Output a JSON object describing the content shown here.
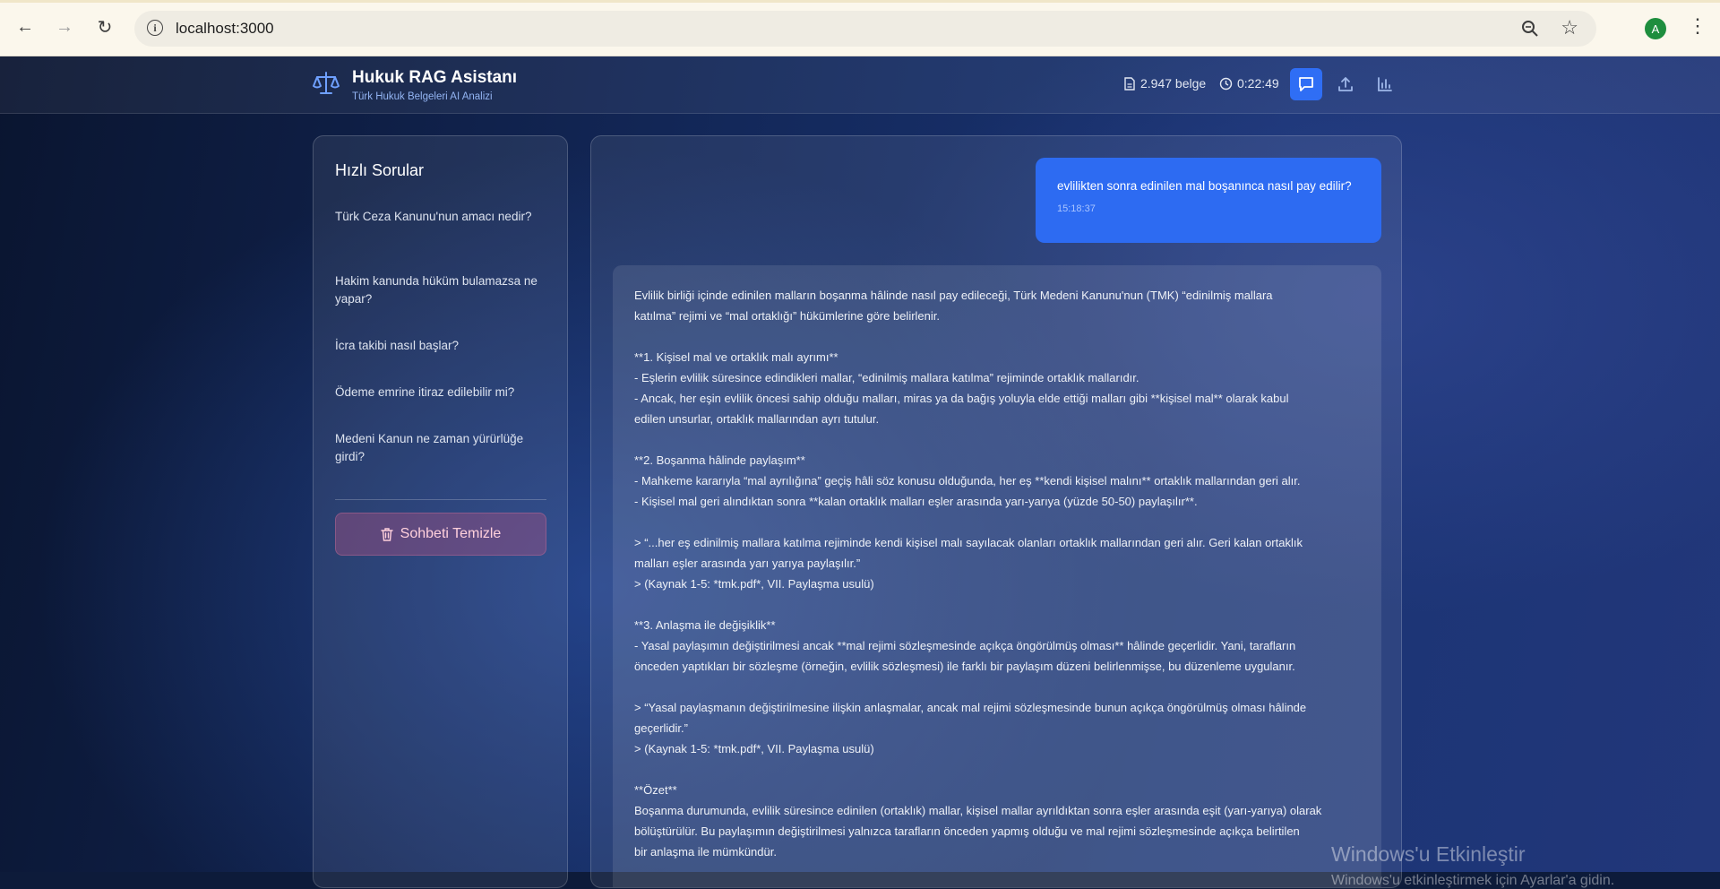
{
  "browser": {
    "url": "localhost:3000",
    "profile_initial": "A"
  },
  "header": {
    "title": "Hukuk RAG Asistanı",
    "subtitle": "Türk Hukuk Belgeleri AI Analizi",
    "doc_count": "2.947 belge",
    "timer": "0:22:49",
    "accent_color": "#2f6ef5"
  },
  "sidebar": {
    "title": "Hızlı Sorular",
    "questions": [
      "Türk Ceza Kanunu'nun amacı nedir?",
      "Hakim kanunda hüküm bulamazsa ne yapar?",
      "İcra takibi nasıl başlar?",
      "Ödeme emrine itiraz edilebilir mi?",
      "Medeni Kanun ne zaman yürürlüğe girdi?"
    ],
    "clear_label": "Sohbeti Temizle"
  },
  "chat": {
    "user_message": "evlilikten sonra edinilen mal boşanınca nasıl pay edilir?",
    "user_time": "15:18:37",
    "answer": [
      [
        "Evlilik birliği içinde edinilen malların boşanma hâlinde nasıl pay edileceği, Türk Medeni Kanunu'nun (TMK) “edinilmiş mallara",
        "katılma” rejimi ve “mal ortaklığı” hükümlerine göre belirlenir."
      ],
      [
        "**1. Kişisel mal ve ortaklık malı ayrımı**",
        "- Eşlerin evlilik süresince edindikleri mallar, “edinilmiş mallara katılma” rejiminde ortaklık mallarıdır.",
        "- Ancak, her eşin evlilik öncesi sahip olduğu malları, miras ya da bağış yoluyla elde ettiği malları gibi **kişisel mal** olarak kabul",
        "edilen unsurlar, ortaklık mallarından ayrı tutulur."
      ],
      [
        "**2. Boşanma hâlinde paylaşım**",
        "- Mahkeme kararıyla “mal ayrılığına” geçiş hâli söz konusu olduğunda, her eş **kendi kişisel malını** ortaklık mallarından geri alır.",
        "- Kişisel mal geri alındıktan sonra **kalan ortaklık malları eşler arasında yarı-yarıya (yüzde 50-50) paylaşılır**."
      ],
      [
        "> “...her eş edinilmiş mallara katılma rejiminde kendi kişisel malı sayılacak olanları ortaklık mallarından geri alır. Geri kalan ortaklık",
        "malları eşler arasında yarı yarıya paylaşılır.”",
        "> (Kaynak 1-5: *tmk.pdf*, VII. Paylaşma usulü)"
      ],
      [
        "**3. Anlaşma ile değişiklik**",
        "- Yasal paylaşımın değiştirilmesi ancak **mal rejimi sözleşmesinde açıkça öngörülmüş olması** hâlinde geçerlidir. Yani, tarafların",
        "önceden yaptıkları bir sözleşme (örneğin, evlilik sözleşmesi) ile farklı bir paylaşım düzeni belirlenmişse, bu düzenleme uygulanır."
      ],
      [
        "> “Yasal paylaşmanın değiştirilmesine ilişkin anlaşmalar, ancak mal rejimi sözleşmesinde bunun açıkça öngörülmüş olması hâlinde",
        "geçerlidir.”",
        "> (Kaynak 1-5: *tmk.pdf*, VII. Paylaşma usulü)"
      ],
      [
        "**Özet**",
        "Boşanma durumunda, evlilik süresince edinilen (ortaklık) mallar, kişisel mallar ayrıldıktan sonra eşler arasında eşit (yarı-yarıya) olarak",
        "bölüştürülür. Bu paylaşımın değiştirilmesi yalnızca tarafların önceden yapmış olduğu ve mal rejimi sözleşmesinde açıkça belirtilen",
        "bir anlaşma ile mümkündür."
      ]
    ]
  },
  "watermark": {
    "line1": "Windows'u Etkinleştir",
    "line2": "Windows'u etkinleştirmek için Ayarlar'a gidin."
  }
}
